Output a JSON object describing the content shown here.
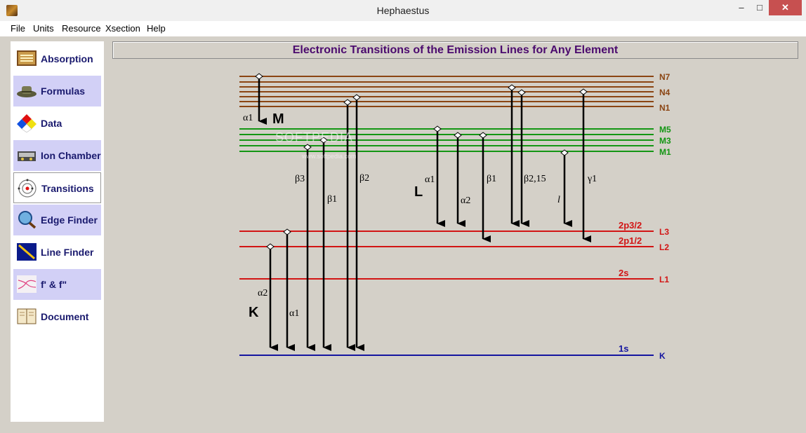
{
  "window": {
    "title": "Hephaestus",
    "minimize": "–",
    "maximize": "□",
    "close": "✕"
  },
  "menu": [
    {
      "label": "File"
    },
    {
      "label": "Units"
    },
    {
      "label": "Resource"
    },
    {
      "label": "Xsection"
    },
    {
      "label": "Help"
    }
  ],
  "sidebar": [
    {
      "label": "Absorption",
      "icon": "gold-plaque-icon",
      "style": "plain"
    },
    {
      "label": "Formulas",
      "icon": "hat-icon",
      "style": "alt"
    },
    {
      "label": "Data",
      "icon": "diamond-hazard-icon",
      "style": "plain"
    },
    {
      "label": "Ion Chamber",
      "icon": "ion-chamber-icon",
      "style": "alt"
    },
    {
      "label": "Transitions",
      "icon": "atom-icon",
      "style": "active"
    },
    {
      "label": "Edge Finder",
      "icon": "magnifier-icon",
      "style": "alt"
    },
    {
      "label": "Line Finder",
      "icon": "ruler-icon",
      "style": "plain"
    },
    {
      "label": "f' & f\"",
      "icon": "curve-plot-icon",
      "style": "alt"
    },
    {
      "label": "Document",
      "icon": "book-icon",
      "style": "plain"
    }
  ],
  "panel": {
    "title": "Electronic Transitions of the Emission Lines for Any Element"
  },
  "colors": {
    "n_shell": "#8b4513",
    "m_shell": "#149614",
    "l_shell": "#d21414",
    "k_shell": "#1414a0",
    "arrow": "#000000"
  },
  "levels": {
    "N": {
      "labels": [
        "N7",
        "N4",
        "N1"
      ]
    },
    "M": {
      "labels": [
        "M5",
        "M3",
        "M1"
      ]
    },
    "L": [
      {
        "orbital": "2p3/2",
        "name": "L3"
      },
      {
        "orbital": "2p1/2",
        "name": "L2"
      },
      {
        "orbital": "2s",
        "name": "L1"
      }
    ],
    "K": {
      "orbital": "1s",
      "name": "K"
    }
  },
  "series": [
    {
      "letter": "M",
      "lines": [
        {
          "label": "α1"
        }
      ]
    },
    {
      "letter": "K",
      "lines": [
        {
          "label": "α2"
        },
        {
          "label": "α1"
        },
        {
          "label": "β3"
        },
        {
          "label": "β1"
        },
        {
          "label": "β2"
        }
      ]
    },
    {
      "letter": "L",
      "lines": [
        {
          "label": "α1"
        },
        {
          "label": "α2"
        },
        {
          "label": "β1"
        },
        {
          "label": "β2,15"
        },
        {
          "label": "l"
        },
        {
          "label": "γ1"
        }
      ]
    }
  ],
  "watermark": {
    "text": "SOFTPEDIA",
    "sub": "www.softpedia.com"
  }
}
